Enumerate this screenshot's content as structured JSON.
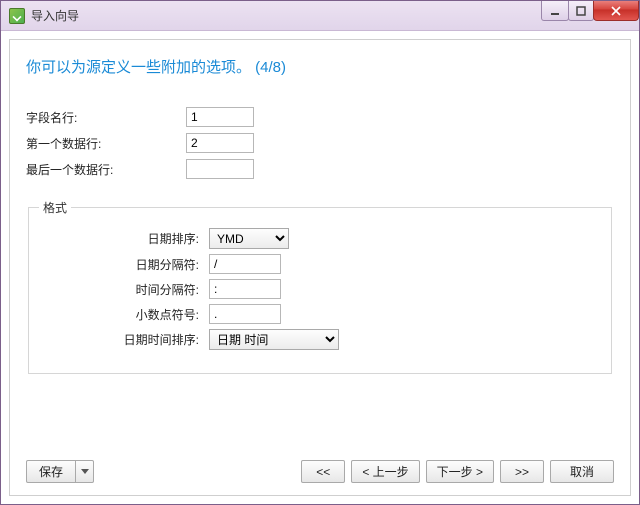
{
  "window": {
    "title": "导入向导"
  },
  "heading": "你可以为源定义一些附加的选项。 (4/8)",
  "rows": {
    "fieldNameRow": {
      "label": "字段名行:",
      "value": "1"
    },
    "firstDataRow": {
      "label": "第一个数据行:",
      "value": "2"
    },
    "lastDataRow": {
      "label": "最后一个数据行:",
      "value": ""
    }
  },
  "format": {
    "legend": "格式",
    "dateOrder": {
      "label": "日期排序:",
      "value": "YMD"
    },
    "dateSeparator": {
      "label": "日期分隔符:",
      "value": "/"
    },
    "timeSeparator": {
      "label": "时间分隔符:",
      "value": ":"
    },
    "decimalSymbol": {
      "label": "小数点符号:",
      "value": "."
    },
    "datetimeOrder": {
      "label": "日期时间排序:",
      "value": "日期 时间"
    }
  },
  "footer": {
    "save": "保存",
    "first": "<<",
    "prev": "< 上一步",
    "next": "下一步 >",
    "last": ">>",
    "cancel": "取消"
  }
}
